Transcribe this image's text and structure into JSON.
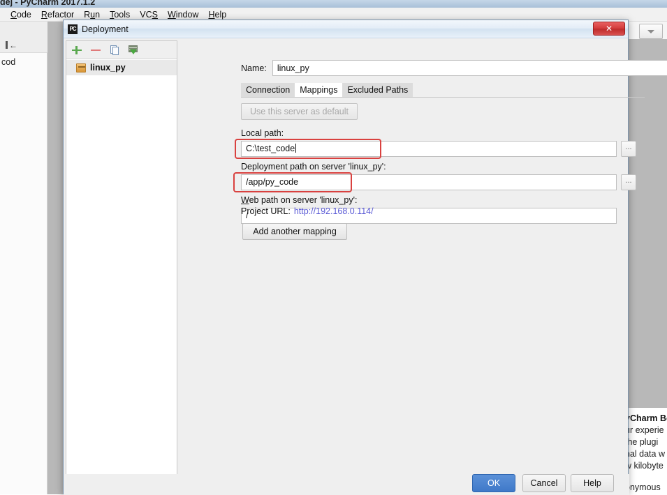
{
  "ide": {
    "window_title": "dej - PyCharm 2017.1.2",
    "menu": [
      {
        "label": "Code",
        "mnemonic": "C"
      },
      {
        "label": "Refactor",
        "mnemonic": "R"
      },
      {
        "label": "Run",
        "mnemonic": "u"
      },
      {
        "label": "Tools",
        "mnemonic": "T"
      },
      {
        "label": "VCS",
        "mnemonic": "S"
      },
      {
        "label": "Window",
        "mnemonic": "W"
      },
      {
        "label": "Help",
        "mnemonic": "H"
      }
    ],
    "tree_label": "cod",
    "notification": {
      "title": "yCharm Bo",
      "lines": [
        "ur experie",
        " the plugi",
        "nal data w",
        "w kilobyte"
      ],
      "footer": "onymous"
    }
  },
  "dialog": {
    "app_icon_text": "PC",
    "title": "Deployment",
    "close_label": "✕",
    "server_panel": {
      "toolbar": [
        {
          "name": "add",
          "icon": "plus-icon"
        },
        {
          "name": "remove",
          "icon": "minus-icon"
        },
        {
          "name": "copy",
          "icon": "copy-icon"
        },
        {
          "name": "import",
          "icon": "server-download-icon"
        }
      ],
      "servers": [
        {
          "label": "linux_py",
          "selected": true
        }
      ]
    },
    "name": {
      "label": "Name:",
      "value": "linux_py"
    },
    "tabs": [
      {
        "label": "Connection",
        "active": false
      },
      {
        "label": "Mappings",
        "active": true
      },
      {
        "label": "Excluded Paths",
        "active": false
      }
    ],
    "use_default_button": "Use this server as default",
    "local_path": {
      "label": "Local path:",
      "value": "C:\\test_code",
      "highlighted": true
    },
    "deployment_path": {
      "label": "Deployment path on server 'linux_py':",
      "value": "/app/py_code",
      "highlighted": true
    },
    "web_path": {
      "label_mnemonic": "W",
      "label_rest": "eb path on server 'linux_py':",
      "label": "Web path on server 'linux_py':",
      "value": "/"
    },
    "browse_button_label": "...",
    "project_url": {
      "label": "Project URL:",
      "link": "http://192.168.0.114/",
      "link_color": "#5b5bd6"
    },
    "add_mapping_button": "Add another mapping",
    "footer": {
      "ok": "OK",
      "cancel": "Cancel",
      "help": "Help"
    },
    "highlight_color": "#d9413f",
    "accent_color": "#3f79c8"
  }
}
